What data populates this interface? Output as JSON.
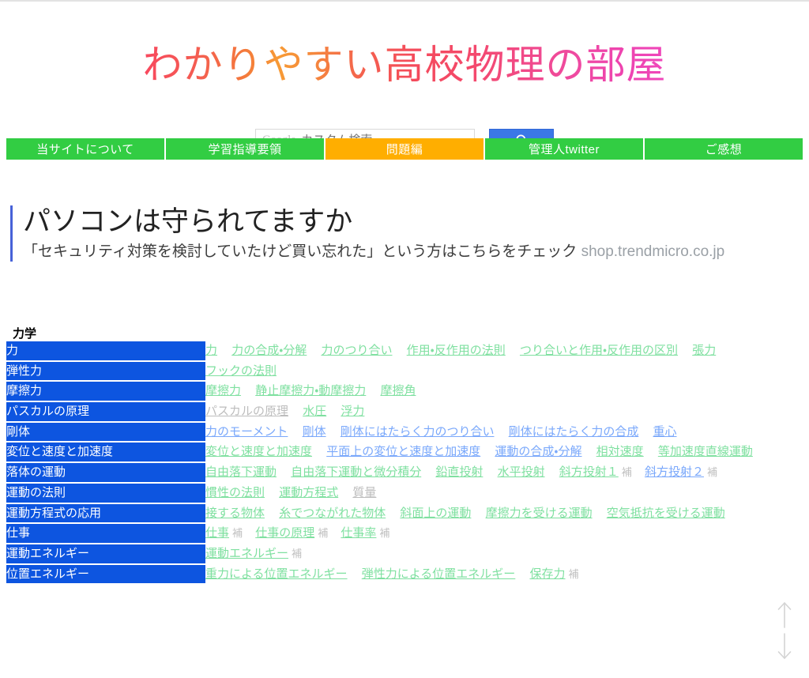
{
  "site": {
    "title": "わかりやすい高校物理の部屋"
  },
  "search": {
    "brand": "Google",
    "placeholder": "カスタム検索",
    "value": "",
    "button_icon": "search-icon",
    "button_color": "#3b78e7"
  },
  "nav": {
    "items": [
      {
        "label": "当サイトについて",
        "accent": false
      },
      {
        "label": "学習指導要領",
        "accent": false
      },
      {
        "label": "問題編",
        "accent": true
      },
      {
        "label": "管理人twitter",
        "accent": false
      },
      {
        "label": "ご感想",
        "accent": false
      }
    ],
    "colors": {
      "normal": "#32cd43",
      "accent": "#ffae00"
    }
  },
  "ad": {
    "title": "パソコンは守られてますか",
    "subtitle": "「セキュリティ対策を検討していたけど買い忘れた」という方はこちらをチェック",
    "url": "shop.trendmicro.co.jp",
    "accent_color": "#4762d8"
  },
  "content": {
    "heading": "力学",
    "rows": [
      {
        "category": "力",
        "links": [
          {
            "label": "力",
            "state": "green"
          },
          {
            "label": "力の合成・分解",
            "state": "green"
          },
          {
            "label": "力のつり合い",
            "state": "green"
          },
          {
            "label": "作用・反作用の法則",
            "state": "green"
          },
          {
            "label": "つり合いと作用・反作用の区別",
            "state": "green"
          },
          {
            "label": "張力",
            "state": "green"
          }
        ]
      },
      {
        "category": "弾性力",
        "links": [
          {
            "label": "フックの法則",
            "state": "green"
          }
        ]
      },
      {
        "category": "摩擦力",
        "links": [
          {
            "label": "摩擦力",
            "state": "green"
          },
          {
            "label": "静止摩擦力・動摩擦力",
            "state": "green"
          },
          {
            "label": "摩擦角",
            "state": "green"
          }
        ]
      },
      {
        "category": "パスカルの原理",
        "links": [
          {
            "label": "パスカルの原理",
            "state": "visited"
          },
          {
            "label": "水圧",
            "state": "green"
          },
          {
            "label": "浮力",
            "state": "green"
          }
        ]
      },
      {
        "category": "剛体",
        "links": [
          {
            "label": "力のモーメント",
            "state": "blue"
          },
          {
            "label": "剛体",
            "state": "blue"
          },
          {
            "label": "剛体にはたらく力のつり合い",
            "state": "blue"
          },
          {
            "label": "剛体にはたらく力の合成",
            "state": "blue"
          },
          {
            "label": "重心",
            "state": "blue"
          }
        ]
      },
      {
        "category": "変位と速度と加速度",
        "links": [
          {
            "label": "変位と速度と加速度",
            "state": "green"
          },
          {
            "label": "平面上の変位と速度と加速度",
            "state": "blue"
          },
          {
            "label": "運動の合成・分解",
            "state": "blue"
          },
          {
            "label": "相対速度",
            "state": "green"
          },
          {
            "label": "等加速度直線運動",
            "state": "green"
          }
        ]
      },
      {
        "category": "落体の運動",
        "links": [
          {
            "label": "自由落下運動",
            "state": "green"
          },
          {
            "label": "自由落下運動と微分積分",
            "state": "green"
          },
          {
            "label": "鉛直投射",
            "state": "green"
          },
          {
            "label": "水平投射",
            "state": "green"
          },
          {
            "label": "斜方投射１",
            "state": "green",
            "sup": "補"
          },
          {
            "label": "斜方投射２",
            "state": "blue",
            "sup": "補"
          }
        ]
      },
      {
        "category": "運動の法則",
        "links": [
          {
            "label": "慣性の法則",
            "state": "green"
          },
          {
            "label": "運動方程式",
            "state": "green"
          },
          {
            "label": "質量",
            "state": "visited"
          }
        ]
      },
      {
        "category": "運動方程式の応用",
        "links": [
          {
            "label": "接する物体",
            "state": "green"
          },
          {
            "label": "糸でつながれた物体",
            "state": "green"
          },
          {
            "label": "斜面上の運動",
            "state": "green"
          },
          {
            "label": "摩擦力を受ける運動",
            "state": "green"
          },
          {
            "label": "空気抵抗を受ける運動",
            "state": "green"
          }
        ]
      },
      {
        "category": "仕事",
        "links": [
          {
            "label": "仕事",
            "state": "green",
            "sup": "補"
          },
          {
            "label": "仕事の原理",
            "state": "green",
            "sup": "補"
          },
          {
            "label": "仕事率",
            "state": "green",
            "sup": "補"
          }
        ]
      },
      {
        "category": "運動エネルギー",
        "links": [
          {
            "label": "運動エネルギー",
            "state": "green",
            "sup": "補"
          }
        ]
      },
      {
        "category": "位置エネルギー",
        "links": [
          {
            "label": "重力による位置エネルギー",
            "state": "green"
          },
          {
            "label": "弾性力による位置エネルギー",
            "state": "green"
          },
          {
            "label": "保存力",
            "state": "green",
            "sup": "補"
          }
        ]
      }
    ]
  },
  "scroll": {
    "up_icon": "arrow-up-icon",
    "down_icon": "arrow-down-icon"
  }
}
